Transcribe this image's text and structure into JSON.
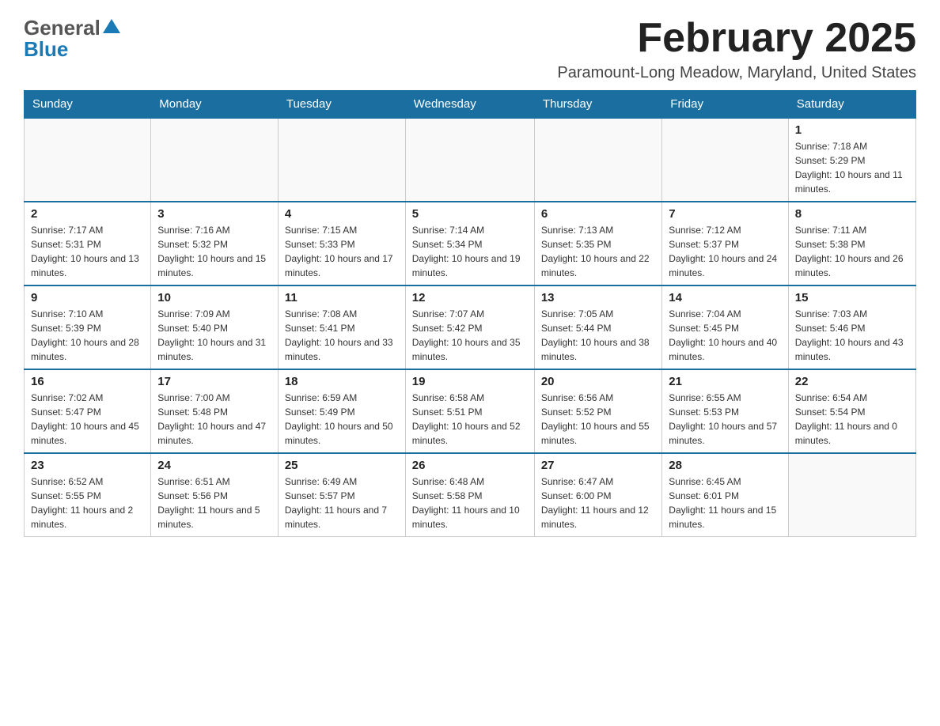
{
  "header": {
    "logo_general": "General",
    "logo_blue": "Blue",
    "month_title": "February 2025",
    "location": "Paramount-Long Meadow, Maryland, United States"
  },
  "weekdays": [
    "Sunday",
    "Monday",
    "Tuesday",
    "Wednesday",
    "Thursday",
    "Friday",
    "Saturday"
  ],
  "weeks": [
    [
      {
        "day": "",
        "info": ""
      },
      {
        "day": "",
        "info": ""
      },
      {
        "day": "",
        "info": ""
      },
      {
        "day": "",
        "info": ""
      },
      {
        "day": "",
        "info": ""
      },
      {
        "day": "",
        "info": ""
      },
      {
        "day": "1",
        "info": "Sunrise: 7:18 AM\nSunset: 5:29 PM\nDaylight: 10 hours and 11 minutes."
      }
    ],
    [
      {
        "day": "2",
        "info": "Sunrise: 7:17 AM\nSunset: 5:31 PM\nDaylight: 10 hours and 13 minutes."
      },
      {
        "day": "3",
        "info": "Sunrise: 7:16 AM\nSunset: 5:32 PM\nDaylight: 10 hours and 15 minutes."
      },
      {
        "day": "4",
        "info": "Sunrise: 7:15 AM\nSunset: 5:33 PM\nDaylight: 10 hours and 17 minutes."
      },
      {
        "day": "5",
        "info": "Sunrise: 7:14 AM\nSunset: 5:34 PM\nDaylight: 10 hours and 19 minutes."
      },
      {
        "day": "6",
        "info": "Sunrise: 7:13 AM\nSunset: 5:35 PM\nDaylight: 10 hours and 22 minutes."
      },
      {
        "day": "7",
        "info": "Sunrise: 7:12 AM\nSunset: 5:37 PM\nDaylight: 10 hours and 24 minutes."
      },
      {
        "day": "8",
        "info": "Sunrise: 7:11 AM\nSunset: 5:38 PM\nDaylight: 10 hours and 26 minutes."
      }
    ],
    [
      {
        "day": "9",
        "info": "Sunrise: 7:10 AM\nSunset: 5:39 PM\nDaylight: 10 hours and 28 minutes."
      },
      {
        "day": "10",
        "info": "Sunrise: 7:09 AM\nSunset: 5:40 PM\nDaylight: 10 hours and 31 minutes."
      },
      {
        "day": "11",
        "info": "Sunrise: 7:08 AM\nSunset: 5:41 PM\nDaylight: 10 hours and 33 minutes."
      },
      {
        "day": "12",
        "info": "Sunrise: 7:07 AM\nSunset: 5:42 PM\nDaylight: 10 hours and 35 minutes."
      },
      {
        "day": "13",
        "info": "Sunrise: 7:05 AM\nSunset: 5:44 PM\nDaylight: 10 hours and 38 minutes."
      },
      {
        "day": "14",
        "info": "Sunrise: 7:04 AM\nSunset: 5:45 PM\nDaylight: 10 hours and 40 minutes."
      },
      {
        "day": "15",
        "info": "Sunrise: 7:03 AM\nSunset: 5:46 PM\nDaylight: 10 hours and 43 minutes."
      }
    ],
    [
      {
        "day": "16",
        "info": "Sunrise: 7:02 AM\nSunset: 5:47 PM\nDaylight: 10 hours and 45 minutes."
      },
      {
        "day": "17",
        "info": "Sunrise: 7:00 AM\nSunset: 5:48 PM\nDaylight: 10 hours and 47 minutes."
      },
      {
        "day": "18",
        "info": "Sunrise: 6:59 AM\nSunset: 5:49 PM\nDaylight: 10 hours and 50 minutes."
      },
      {
        "day": "19",
        "info": "Sunrise: 6:58 AM\nSunset: 5:51 PM\nDaylight: 10 hours and 52 minutes."
      },
      {
        "day": "20",
        "info": "Sunrise: 6:56 AM\nSunset: 5:52 PM\nDaylight: 10 hours and 55 minutes."
      },
      {
        "day": "21",
        "info": "Sunrise: 6:55 AM\nSunset: 5:53 PM\nDaylight: 10 hours and 57 minutes."
      },
      {
        "day": "22",
        "info": "Sunrise: 6:54 AM\nSunset: 5:54 PM\nDaylight: 11 hours and 0 minutes."
      }
    ],
    [
      {
        "day": "23",
        "info": "Sunrise: 6:52 AM\nSunset: 5:55 PM\nDaylight: 11 hours and 2 minutes."
      },
      {
        "day": "24",
        "info": "Sunrise: 6:51 AM\nSunset: 5:56 PM\nDaylight: 11 hours and 5 minutes."
      },
      {
        "day": "25",
        "info": "Sunrise: 6:49 AM\nSunset: 5:57 PM\nDaylight: 11 hours and 7 minutes."
      },
      {
        "day": "26",
        "info": "Sunrise: 6:48 AM\nSunset: 5:58 PM\nDaylight: 11 hours and 10 minutes."
      },
      {
        "day": "27",
        "info": "Sunrise: 6:47 AM\nSunset: 6:00 PM\nDaylight: 11 hours and 12 minutes."
      },
      {
        "day": "28",
        "info": "Sunrise: 6:45 AM\nSunset: 6:01 PM\nDaylight: 11 hours and 15 minutes."
      },
      {
        "day": "",
        "info": ""
      }
    ]
  ]
}
